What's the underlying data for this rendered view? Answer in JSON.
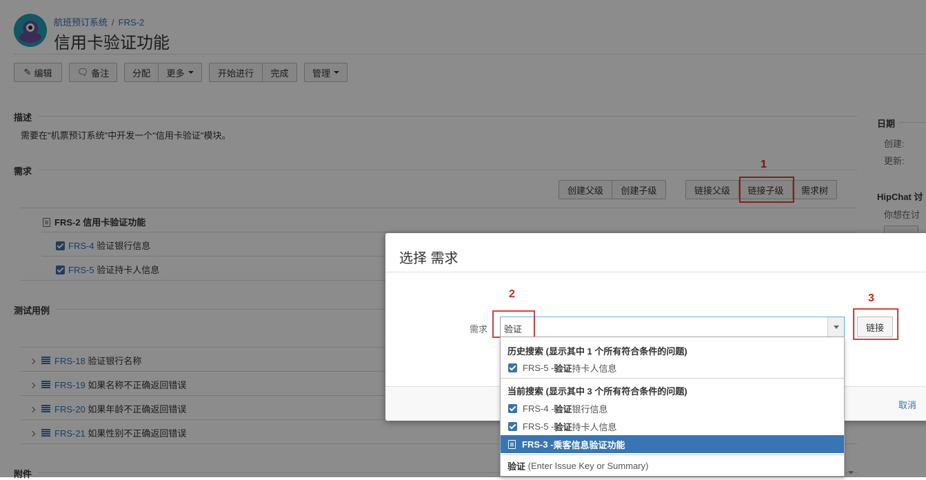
{
  "header": {
    "breadcrumb_project": "航班预订系统",
    "breadcrumb_sep": "/",
    "breadcrumb_key": "FRS-2",
    "title": "信用卡验证功能"
  },
  "toolbar": {
    "edit": "编辑",
    "comment": "备注",
    "assign": "分配",
    "more": "更多",
    "start": "开始进行",
    "done": "完成",
    "admin": "管理"
  },
  "description": {
    "title": "描述",
    "text": "需要在\"机票预订系统\"中开发一个\"信用卡验证\"模块。"
  },
  "requirements": {
    "title": "需求",
    "buttons": {
      "create_parent": "创建父级",
      "create_child": "创建子级",
      "link_parent": "链接父级",
      "link_child": "链接子级",
      "tree": "需求树"
    },
    "root": {
      "key": "FRS-2",
      "summary": "信用卡验证功能"
    },
    "children": [
      {
        "key": "FRS-4",
        "summary": "验证银行信息"
      },
      {
        "key": "FRS-5",
        "summary": "验证持卡人信息"
      }
    ]
  },
  "tests": {
    "title": "测试用例",
    "items": [
      {
        "key": "FRS-18",
        "summary": "验证银行名称"
      },
      {
        "key": "FRS-19",
        "summary": "如果名称不正确返回错误"
      },
      {
        "key": "FRS-20",
        "summary": "如果年龄不正确返回错误"
      },
      {
        "key": "FRS-21",
        "summary": "如果性别不正确返回错误"
      }
    ]
  },
  "attachments": {
    "title": "附件"
  },
  "right_panel": {
    "dates_title": "日期",
    "created_label": "创建:",
    "updated_label": "更新:",
    "hipchat_title": "HipChat 讨",
    "hipchat_text": "你想在讨"
  },
  "annotations": {
    "n1": "1",
    "n2": "2",
    "n3": "3"
  },
  "dialog": {
    "title": "选择 需求",
    "field_label": "需求",
    "field_value": "验证",
    "link_button": "链接",
    "cancel": "取消"
  },
  "dropdown": {
    "history_header": "历史搜索 (显示其中 1 个所有符合条件的问题)",
    "history_items": [
      {
        "prefix": "FRS-5 - ",
        "match": "验证",
        "rest": "持卡人信息"
      }
    ],
    "current_header": "当前搜索 (显示其中 3 个所有符合条件的问题)",
    "current_items": [
      {
        "prefix": "FRS-4 - ",
        "match": "验证",
        "rest": "银行信息"
      },
      {
        "prefix": "FRS-5 - ",
        "match": "验证",
        "rest": "持卡人信息"
      },
      {
        "prefix": "FRS-3 - ",
        "match": "",
        "rest": "乘客信息验证功能"
      }
    ],
    "footer_match": "验证",
    "footer_hint": " (Enter Issue Key or Summary)"
  },
  "colors": {
    "link": "#3572b0",
    "highlight": "#3875b5",
    "annotation": "#d0251f",
    "avatar": "#1fa0b8"
  }
}
